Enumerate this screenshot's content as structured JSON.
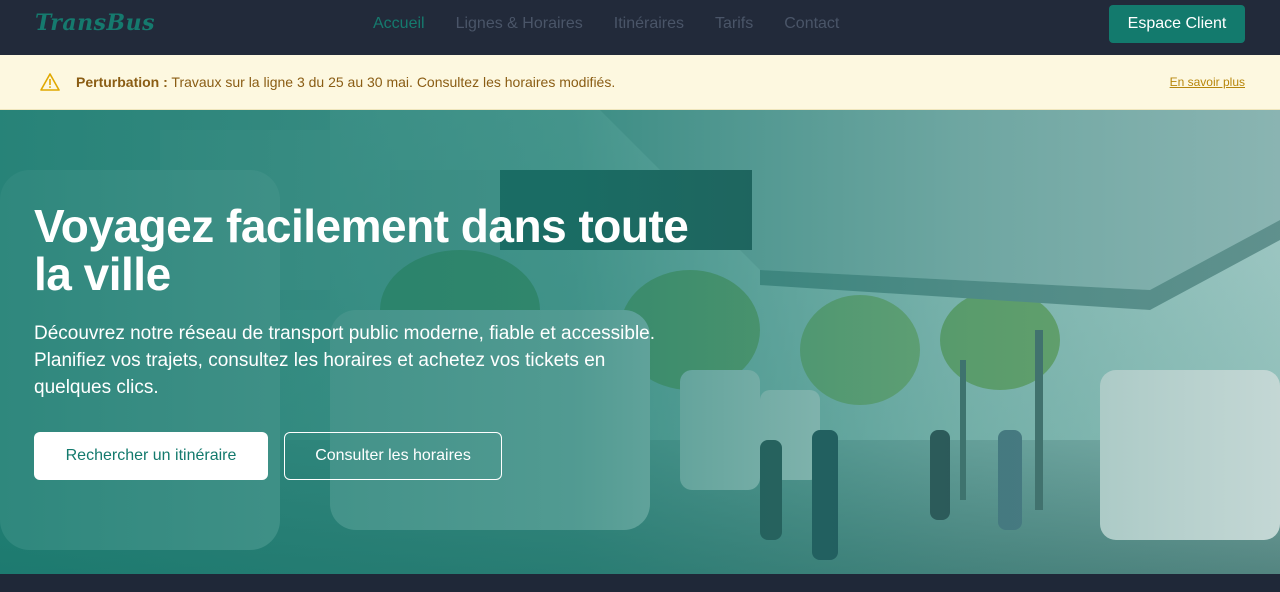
{
  "header": {
    "logo": "TransBus",
    "nav": [
      "Accueil",
      "Lignes & Horaires",
      "Itinéraires",
      "Tarifs",
      "Contact"
    ],
    "active_nav": "Accueil",
    "cta_label": "Espace Client"
  },
  "alert": {
    "icon": "warning-icon",
    "label": "Perturbation :",
    "message": " Travaux sur la ligne 3 du 25 au 30 mai. Consultez les horaires modifiés.",
    "link_label": "En savoir plus"
  },
  "hero": {
    "title": "Voyagez facilement dans toute la ville",
    "description": "Découvrez notre réseau de transport public moderne, fiable et accessible. Planifiez vos trajets, consultez les horaires et achetez vos tickets en quelques clics.",
    "primary_button": "Rechercher un itinéraire",
    "secondary_button": "Consulter les horaires"
  },
  "colors": {
    "brand": "#137a6d",
    "header_bg": "#222a3a",
    "alert_bg": "#fdf8e0",
    "alert_text": "#8a5d14"
  }
}
